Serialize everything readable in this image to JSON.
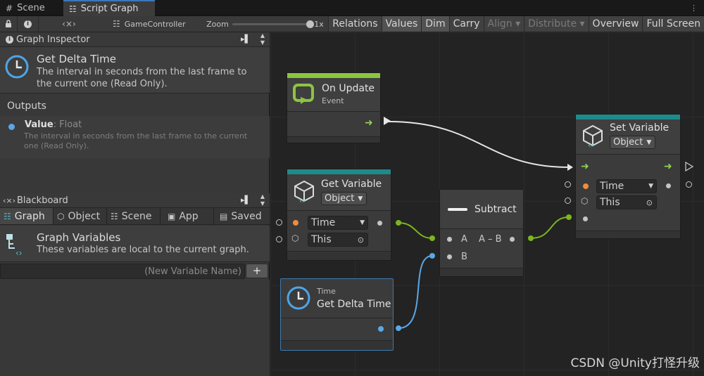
{
  "tabs": [
    {
      "label": "Scene",
      "icon": "grid-icon"
    },
    {
      "label": "Script Graph",
      "icon": "hierarchy-icon"
    }
  ],
  "toolbar": {
    "target": "GameController",
    "zoom_label": "Zoom",
    "zoom_value": "1x",
    "zoom_level": 1.0,
    "right_buttons": [
      "Relations",
      "Values",
      "Dim",
      "Carry",
      "Align ▾",
      "Distribute ▾",
      "Overview",
      "Full Screen"
    ]
  },
  "inspector": {
    "title": "Graph Inspector",
    "unit_title": "Get Delta Time",
    "unit_desc": "The interval in seconds from the last frame to the current one (Read Only).",
    "outputs_label": "Outputs",
    "output_name": "Value",
    "output_type": ": Float",
    "output_desc": "The interval in seconds from the last frame to the current one (Read Only)."
  },
  "blackboard": {
    "title": "Blackboard",
    "tabs": [
      "Graph",
      "Object",
      "Scene",
      "App",
      "Saved"
    ],
    "heading": "Graph Variables",
    "desc": "These variables are local to the current graph.",
    "new_var_placeholder": "(New Variable Name)",
    "add_label": "+"
  },
  "nodes": {
    "on_update": {
      "title": "On Update",
      "subtitle": "Event"
    },
    "get_variable": {
      "title": "Get Variable",
      "kind": "Object",
      "name": "Time",
      "target": "This"
    },
    "subtract": {
      "title": "Subtract",
      "in_a": "A",
      "in_b": "B",
      "out": "A – B"
    },
    "set_variable": {
      "title": "Set Variable",
      "kind": "Object",
      "name": "Time",
      "target": "This"
    },
    "delta_time": {
      "subtitle": "Time",
      "title": "Get Delta Time"
    }
  },
  "watermark": "CSDN @Unity打怪升级",
  "colors": {
    "event_accent": "#8bc53f",
    "variable_accent": "#1f8a8a",
    "float_port": "#5aa7e6",
    "flow_arrow": "#92d050",
    "string_port": "#f28b3b",
    "selection": "#3d7ab0"
  }
}
